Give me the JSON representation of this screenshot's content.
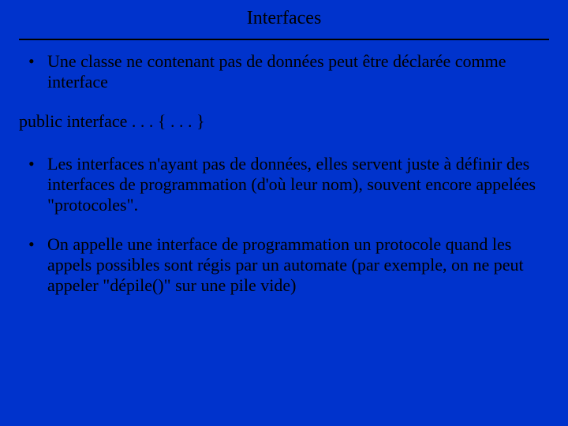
{
  "slide": {
    "title": "Interfaces",
    "bullet1": "Une classe ne contenant pas de données peut être déclarée comme interface",
    "code": "public interface . . . { . . . }",
    "bullet2": "Les interfaces n'ayant pas de données, elles servent juste à définir des interfaces de programmation (d'où leur nom), souvent encore appelées \"protocoles\".",
    "bullet3": "On appelle une interface de programmation un protocole quand les appels possibles sont régis par un automate (par exemple, on ne peut appeler \"dépile()\" sur une pile vide)"
  }
}
